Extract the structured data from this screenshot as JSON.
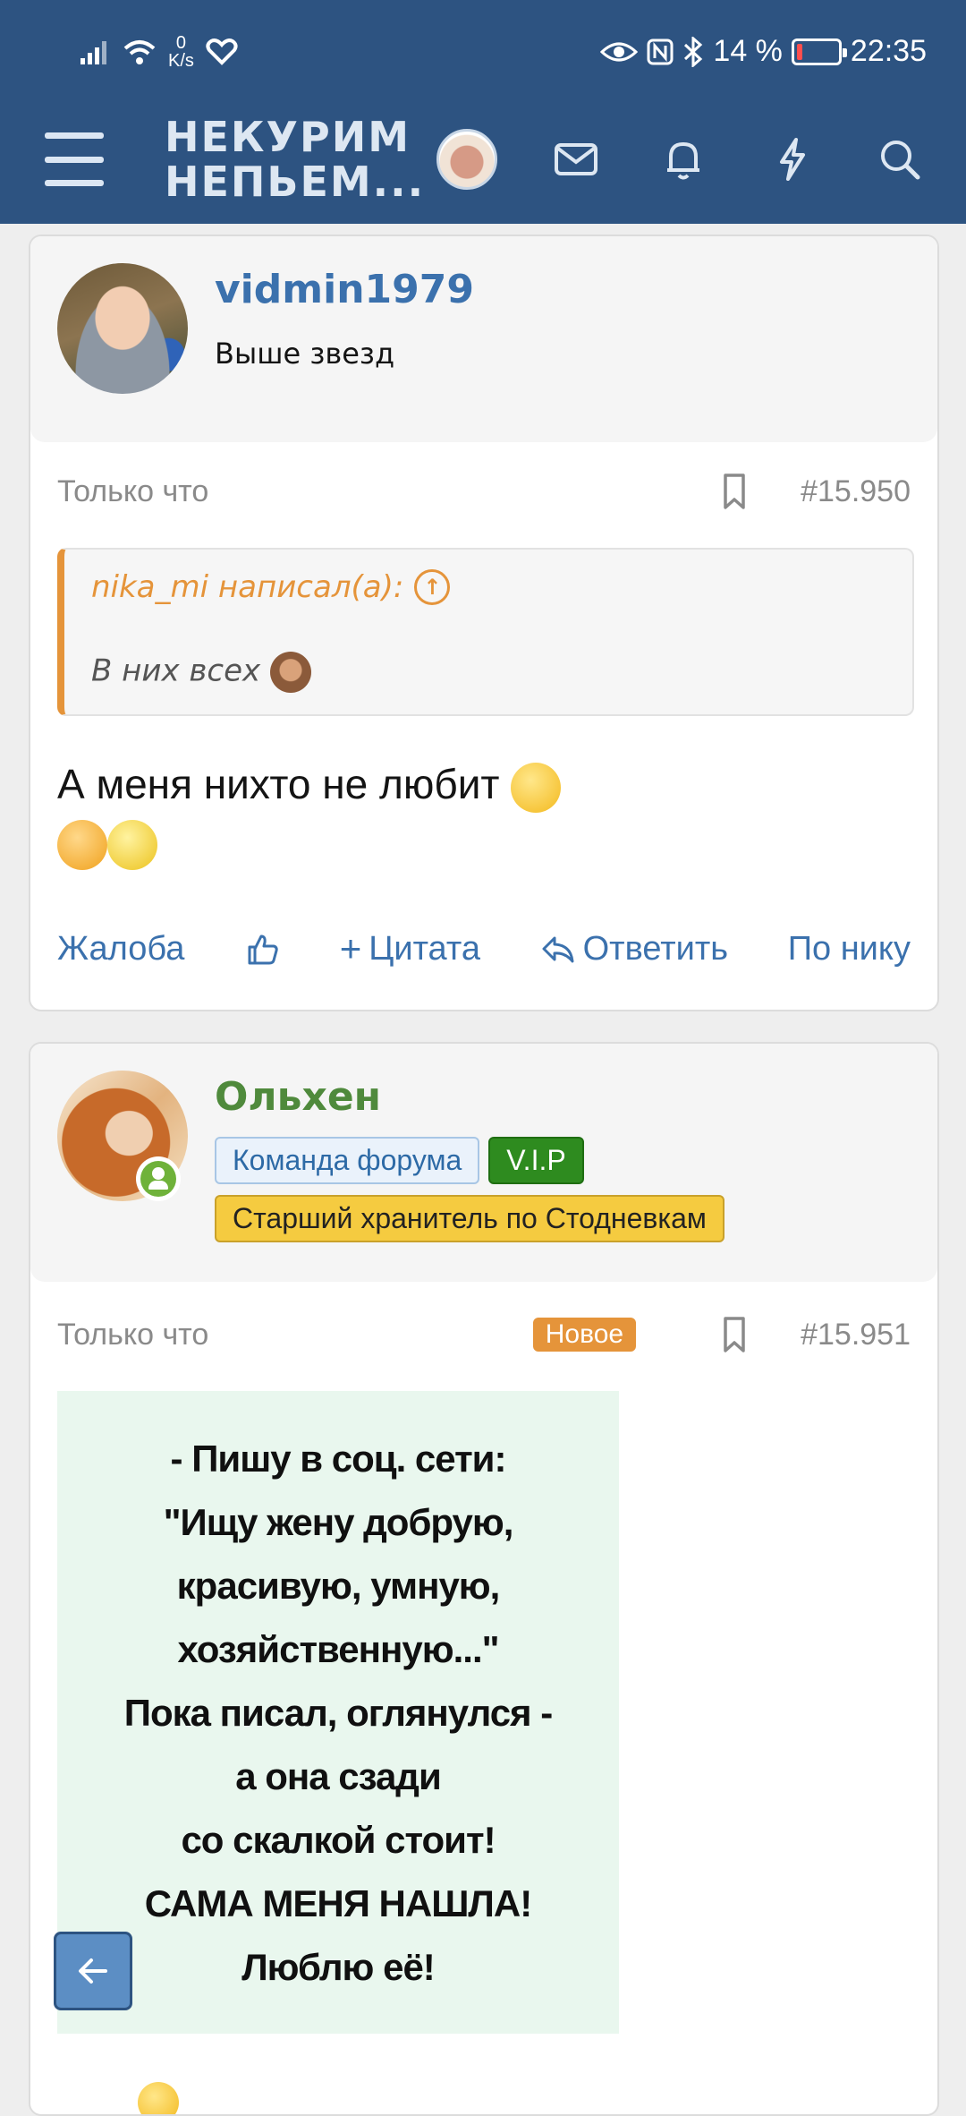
{
  "status_bar": {
    "net_speed_value": "0",
    "net_speed_unit": "K/s",
    "battery_percent": "14 %",
    "time": "22:35"
  },
  "header": {
    "logo_line1": "НЕКУРИМ",
    "logo_line2": "НЕПЬЕМ...",
    "icons": [
      "menu-icon",
      "avatar",
      "envelope-icon",
      "bell-icon",
      "lightning-icon",
      "search-icon"
    ]
  },
  "posts": [
    {
      "username": "vidmin1979",
      "user_title": "Выше звезд",
      "time": "Только что",
      "number": "#15.950",
      "quote": {
        "author": "nika_mi написал(а):",
        "text": "В них всех"
      },
      "text": "А меня нихто не любит",
      "actions": {
        "report": "Жалоба",
        "quote": "Цитата",
        "reply": "Ответить",
        "by_nick": "По нику"
      }
    },
    {
      "username": "Ольхен",
      "badges": {
        "team": "Команда форума",
        "vip": "V.I.P",
        "rank": "Старший хранитель по Стодневкам"
      },
      "time": "Только что",
      "new_badge": "Новое",
      "number": "#15.951",
      "meme_lines": [
        "- Пишу в соц. сети:",
        "\"Ищу жену добрую,",
        "красивую, умную,",
        "хозяйственную...\"",
        "Пока писал, оглянулся -",
        "а она сзади",
        "со скалкой стоит!",
        "САМА МЕНЯ НАШЛА!",
        "Люблю её!"
      ]
    }
  ],
  "colors": {
    "header_bg": "#2d5381",
    "link_blue": "#3b71ad",
    "accent_orange": "#e5943a",
    "vip_green": "#2e8b1f",
    "rank_yellow": "#f5cb40"
  }
}
